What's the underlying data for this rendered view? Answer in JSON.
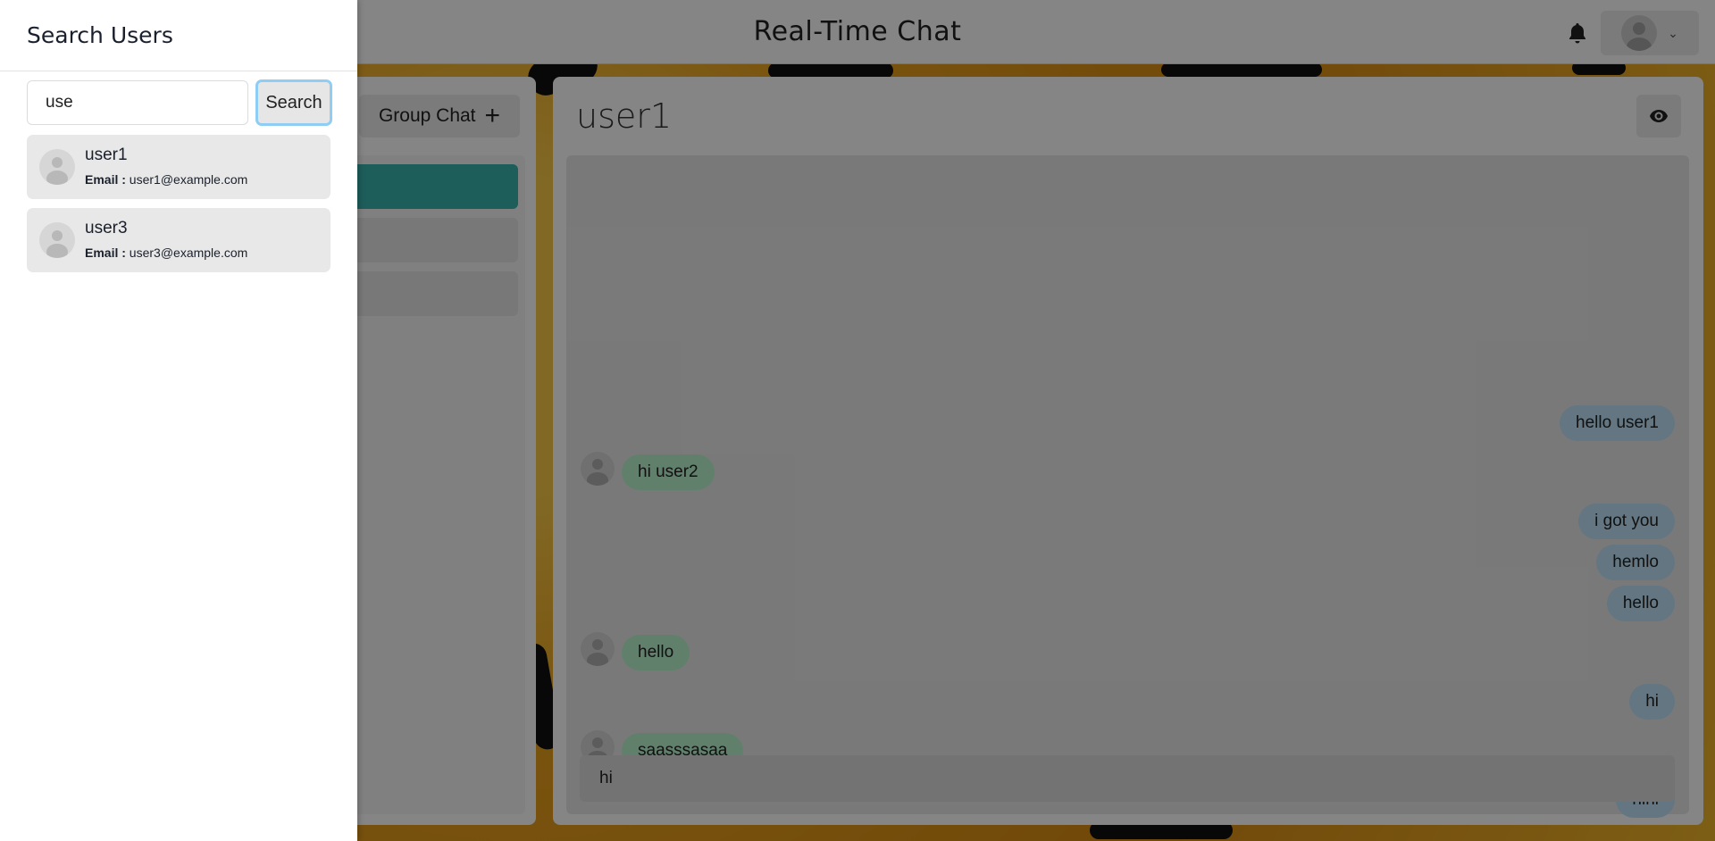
{
  "header": {
    "title": "Real-Time Chat",
    "bell_icon": "bell-icon",
    "profile_icon": "avatar",
    "profile_chevron": "⌄"
  },
  "chat_list": {
    "new_group_label": "Group Chat",
    "plus_glyph": "+"
  },
  "chat": {
    "title": "user1",
    "view_icon": "eye-icon",
    "messages": [
      {
        "text": "hello user1",
        "from": "sent"
      },
      {
        "text": "hi user2",
        "from": "received"
      },
      {
        "text": "i got you",
        "from": "sent"
      },
      {
        "text": "hemlo",
        "from": "sent"
      },
      {
        "text": "hello",
        "from": "sent"
      },
      {
        "text": "hello",
        "from": "received"
      },
      {
        "text": "hi",
        "from": "sent"
      },
      {
        "text": "saasssasaa",
        "from": "received"
      },
      {
        "text": "hihi",
        "from": "sent"
      }
    ],
    "input_value": "hi"
  },
  "drawer": {
    "title": "Search Users",
    "search_value": "use",
    "search_button": "Search",
    "email_label": "Email :",
    "results": [
      {
        "name": "user1",
        "email": "user1@example.com"
      },
      {
        "name": "user3",
        "email": "user3@example.com"
      }
    ]
  },
  "colors": {
    "sent_bubble": "#bee3f8",
    "received_bubble": "#b9f5d0",
    "active_chat": "#38b2ac",
    "search_focus_ring": "#90cdf4"
  }
}
